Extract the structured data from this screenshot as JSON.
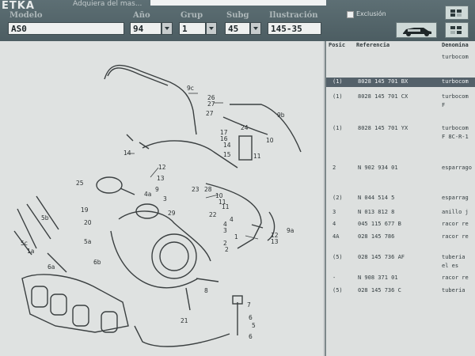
{
  "app": {
    "logo": "ETKA",
    "hint": "Adquiera del mas..."
  },
  "fields": {
    "modelo": {
      "label": "Modelo",
      "value": "AS0"
    },
    "ano": {
      "label": "Año",
      "value": "94"
    },
    "grup": {
      "label": "Grup",
      "value": "1"
    },
    "subg": {
      "label": "Subg",
      "value": "45"
    },
    "ilustracion": {
      "label": "Ilustración",
      "value": "145-35"
    }
  },
  "exclusion_label": "Exclusión",
  "diagram_callouts": [
    "9c",
    "26",
    "27",
    "27",
    "9b",
    "17",
    "16",
    "14",
    "15",
    "24",
    "10",
    "11",
    "14",
    "12",
    "13",
    "9",
    "25",
    "4a",
    "3",
    "23",
    "28",
    "10",
    "11",
    "29",
    "22",
    "11",
    "5b",
    "19",
    "20",
    "5a",
    "5c",
    "1a",
    "6a",
    "6b",
    "2",
    "8",
    "21",
    "7",
    "6",
    "5",
    "6",
    "12",
    "13",
    "9a",
    "1",
    "2",
    "3",
    "4",
    "4"
  ],
  "parts_table": {
    "headers": {
      "pos": "Posic",
      "ref": "Referencia",
      "den": "Denomina"
    },
    "top_text": "turbocom",
    "rows": [
      {
        "pos": "(1)",
        "ref": "8028 145 701 BX",
        "den": "turbocom",
        "sub": "",
        "selected": true
      },
      {
        "pos": "(1)",
        "ref": "8028 145 701 CX",
        "den": "turbocom",
        "sub": "F",
        "selected": false
      },
      {
        "pos": "(1)",
        "ref": "8028 145 701 YX",
        "den": "turbocom",
        "sub": "F 8C-R-1",
        "selected": false
      },
      {
        "pos": "2",
        "ref": "N  902 934 01",
        "den": "esparrago",
        "sub": "",
        "selected": false
      },
      {
        "pos": "(2)",
        "ref": "N  044 514 5",
        "den": "esparrag",
        "sub": "",
        "selected": false
      },
      {
        "pos": "3",
        "ref": "N  013 812 8",
        "den": "anillo j",
        "sub": "",
        "selected": false
      },
      {
        "pos": "4",
        "ref": "045 115 677 B",
        "den": "racor re",
        "sub": "",
        "selected": false
      },
      {
        "pos": "4A",
        "ref": "028 145 786",
        "den": "racor re",
        "sub": "",
        "selected": false
      },
      {
        "pos": "(5)",
        "ref": "028 145 736 AF",
        "den": "tuberia",
        "sub": "el es",
        "selected": false
      },
      {
        "pos": "-",
        "ref": "N  908 371 01",
        "den": "racor re",
        "sub": "",
        "selected": false
      },
      {
        "pos": "(5)",
        "ref": "028 145 736 C",
        "den": "tuberia",
        "sub": "",
        "selected": false
      }
    ]
  },
  "icons": {
    "toolbar1": "grid-icon",
    "toolbar2": "grid-icon",
    "car": "car-icon"
  },
  "colors": {
    "topbar": "#52646a",
    "selected_row": "#54616a",
    "diagram_bg": "#dfe2e1"
  }
}
